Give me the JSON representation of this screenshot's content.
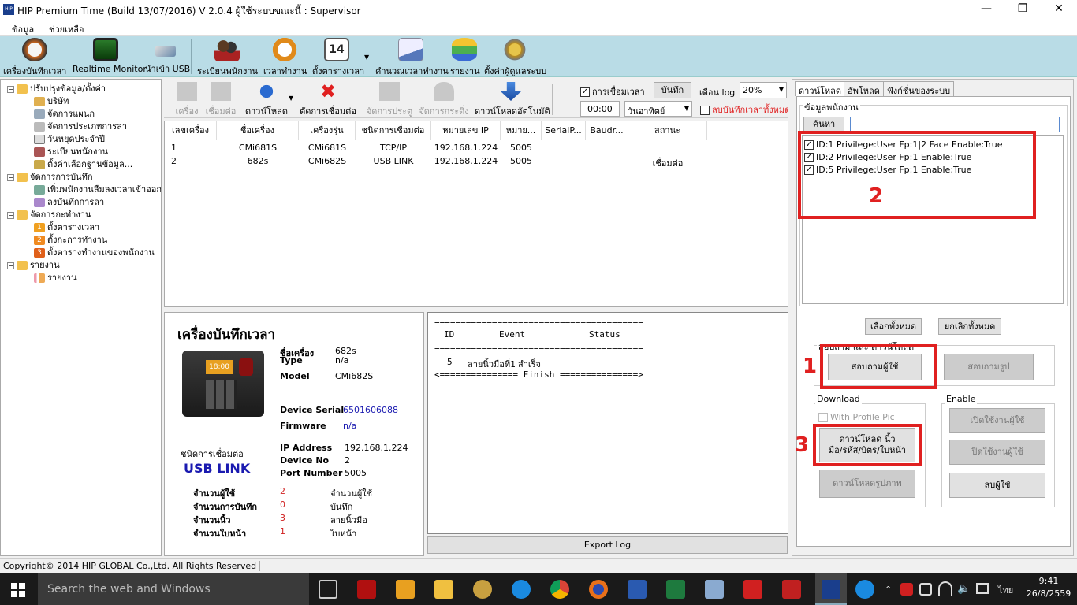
{
  "window": {
    "title": "HIP Premium Time (Build 13/07/2016) V 2.0.4   ผู้ใช้ระบบขณะนี้ : Supervisor",
    "app_icon": "HiP"
  },
  "menu": [
    "ข้อมูล",
    "ช่วยเหลือ"
  ],
  "toolbar": [
    "เครื่องบันทึกเวลา",
    "Realtime Monitor",
    "นำเข้า USB",
    "ระเบียนพนักงาน",
    "เวลาทำงาน",
    "ตั้งตารางเวลา",
    "คำนวณเวลาทำงาน",
    "รายงาน",
    "ตั้งค่าผู้ดูแลระบบ"
  ],
  "toolbar_calendar_day": "14",
  "tree": [
    {
      "label": "ปรับปรุงข้อมูล/ตั้งค่า",
      "level": 0
    },
    {
      "label": "บริษัท",
      "level": 1
    },
    {
      "label": "จัดการแผนก",
      "level": 1
    },
    {
      "label": "จัดการประเภทการลา",
      "level": 1
    },
    {
      "label": "วันหยุดประจำปี",
      "level": 1
    },
    {
      "label": "ระเบียนพนักงาน",
      "level": 1
    },
    {
      "label": "ตั้งค่าเลือกฐานข้อมูล...",
      "level": 1
    },
    {
      "label": "จัดการการบันทึก",
      "level": 0
    },
    {
      "label": "เพิ่มพนักงานลืมลงเวลาเข้าออก",
      "level": 1
    },
    {
      "label": "ลงบันทึกการลา",
      "level": 1
    },
    {
      "label": "จัดการกะทำงาน",
      "level": 0
    },
    {
      "label": "ตั้งตารางเวลา",
      "level": 1,
      "num": "1"
    },
    {
      "label": "ตั้งกะการทำงาน",
      "level": 1,
      "num": "2"
    },
    {
      "label": "ตั้งตารางทำงานของพนักงาน",
      "level": 1,
      "num": "3"
    },
    {
      "label": "รายงาน",
      "level": 0
    },
    {
      "label": "รายงาน",
      "level": 1
    }
  ],
  "device_toolbar": {
    "buttons": [
      "เครื่อง",
      "เชื่อมต่อ",
      "ดาวน์โหลด",
      "ตัดการเชื่อมต่อ",
      "จัดการประตู",
      "จัดการกระดิ่ง",
      "ดาวน์โหลดอัตโนมัติ"
    ],
    "connect_time_label": "การเชื่อมเวลา",
    "save_label": "บันทึก",
    "log_month_label": "เดือน log",
    "log_percent": "20%",
    "time_value": "00:00",
    "day_value": "วันอาทิตย์",
    "delete_label": "ลบบันทึกเวลาทั้งหมด"
  },
  "device_table": {
    "headers": [
      "เลขเครื่อง",
      "ชื่อเครื่อง",
      "เครื่องรุ่น",
      "ชนิดการเชื่อมต่อ",
      "หมายเลข IP",
      "หมาย...",
      "SerialP...",
      "Baudr...",
      "สถานะ"
    ],
    "rows": [
      [
        "1",
        "CMi681S",
        "CMi681S",
        "TCP/IP",
        "192.168.1.224",
        "5005",
        "",
        "",
        ""
      ],
      [
        "2",
        "682s",
        "CMi682S",
        "USB LINK",
        "192.168.1.224",
        "5005",
        "",
        "",
        "เชื่อมต่อ"
      ]
    ]
  },
  "device_info": {
    "heading": "เครื่องบันทึกเวลา",
    "device_screen_time": "18:00",
    "name_label": "ชื่อเครื่อง",
    "name_value": "682s",
    "type_label": "Type",
    "type_value": "n/a",
    "model_label": "Model",
    "model_value": "CMi682S",
    "serial_label": "Device Serial",
    "serial_value": "6501606088",
    "firmware_label": "Firmware",
    "firmware_value": "n/a",
    "conn_label": "ชนิดการเชื่อมต่อ",
    "conn_value": "USB LINK",
    "ip_label": "IP Address",
    "ip_value": "192.168.1.224",
    "devno_label": "Device No",
    "devno_value": "2",
    "port_label": "Port Number",
    "port_value": "5005",
    "stats": [
      {
        "label": "จำนวนผู้ใช้",
        "value": "2",
        "unit": "จำนวนผู้ใช้"
      },
      {
        "label": "จำนวนการบันทึก",
        "value": "0",
        "unit": "บันทึก"
      },
      {
        "label": "จำนวนนิ้ว",
        "value": "3",
        "unit": "ลายนิ้วมือ"
      },
      {
        "label": "จำนวนใบหน้า",
        "value": "1",
        "unit": "ใบหน้า"
      }
    ]
  },
  "log": {
    "sep1": "========================================",
    "head_id": "ID",
    "head_event": "Event",
    "head_status": "Status",
    "sep2": "========================================",
    "row_id": "5",
    "row_event": "ลายนิ้วมือที่1",
    "row_status": "สำเร็จ",
    "finish": "<=============== Finish ===============>",
    "export_label": "Export Log"
  },
  "right": {
    "tabs": [
      "ดาวน์โหลด",
      "อัพโหลด",
      "ฟังก์ชั่นของระบบ"
    ],
    "group_label": "ข้อมูลพนักงาน",
    "search_label": "ค้นหา",
    "search_value": "",
    "employees": [
      "ID:1 Privilege:User Fp:1|2 Face Enable:True",
      "ID:2 Privilege:User Fp:1 Enable:True",
      "ID:5 Privilege:User Fp:1 Enable:True"
    ],
    "select_all": "เลือกทั้งหมด",
    "deselect_all": "ยกเลิกทั้งหมด",
    "query_group_label": "สอบถาม และ ดาวน์โหลด",
    "query_user": "สอบถามผู้ใช้",
    "query_photo": "สอบถามรูป",
    "download_label": "Download",
    "with_profile_pic": "With Profile Pic",
    "download_fp_btn_line1": "ดาวน์โหลด นิ้ว",
    "download_fp_btn_line2": "มือ/รหัส/บัตร/ใบหน้า",
    "download_photo": "ดาวน์โหลดรูปภาพ",
    "enable_label": "Enable",
    "enable_user": "เปิดใช้งานผู้ใช้",
    "disable_user": "ปิดใช้งานผู้ใช้",
    "delete_user": "ลบผู้ใช้",
    "annotations": [
      "1",
      "2",
      "3"
    ]
  },
  "statusbar": {
    "text": "Copyright© 2014 HIP GLOBAL Co.,Ltd. All Rights Reserved"
  },
  "taskbar": {
    "search_placeholder": "Search the web and Windows",
    "lang": "ไทย",
    "time": "9:41",
    "date": "26/8/2559"
  },
  "colors": {
    "toolbar_bg": "#b9dce6",
    "annotation_red": "#e02020",
    "link_blue": "#1a1ab0"
  }
}
